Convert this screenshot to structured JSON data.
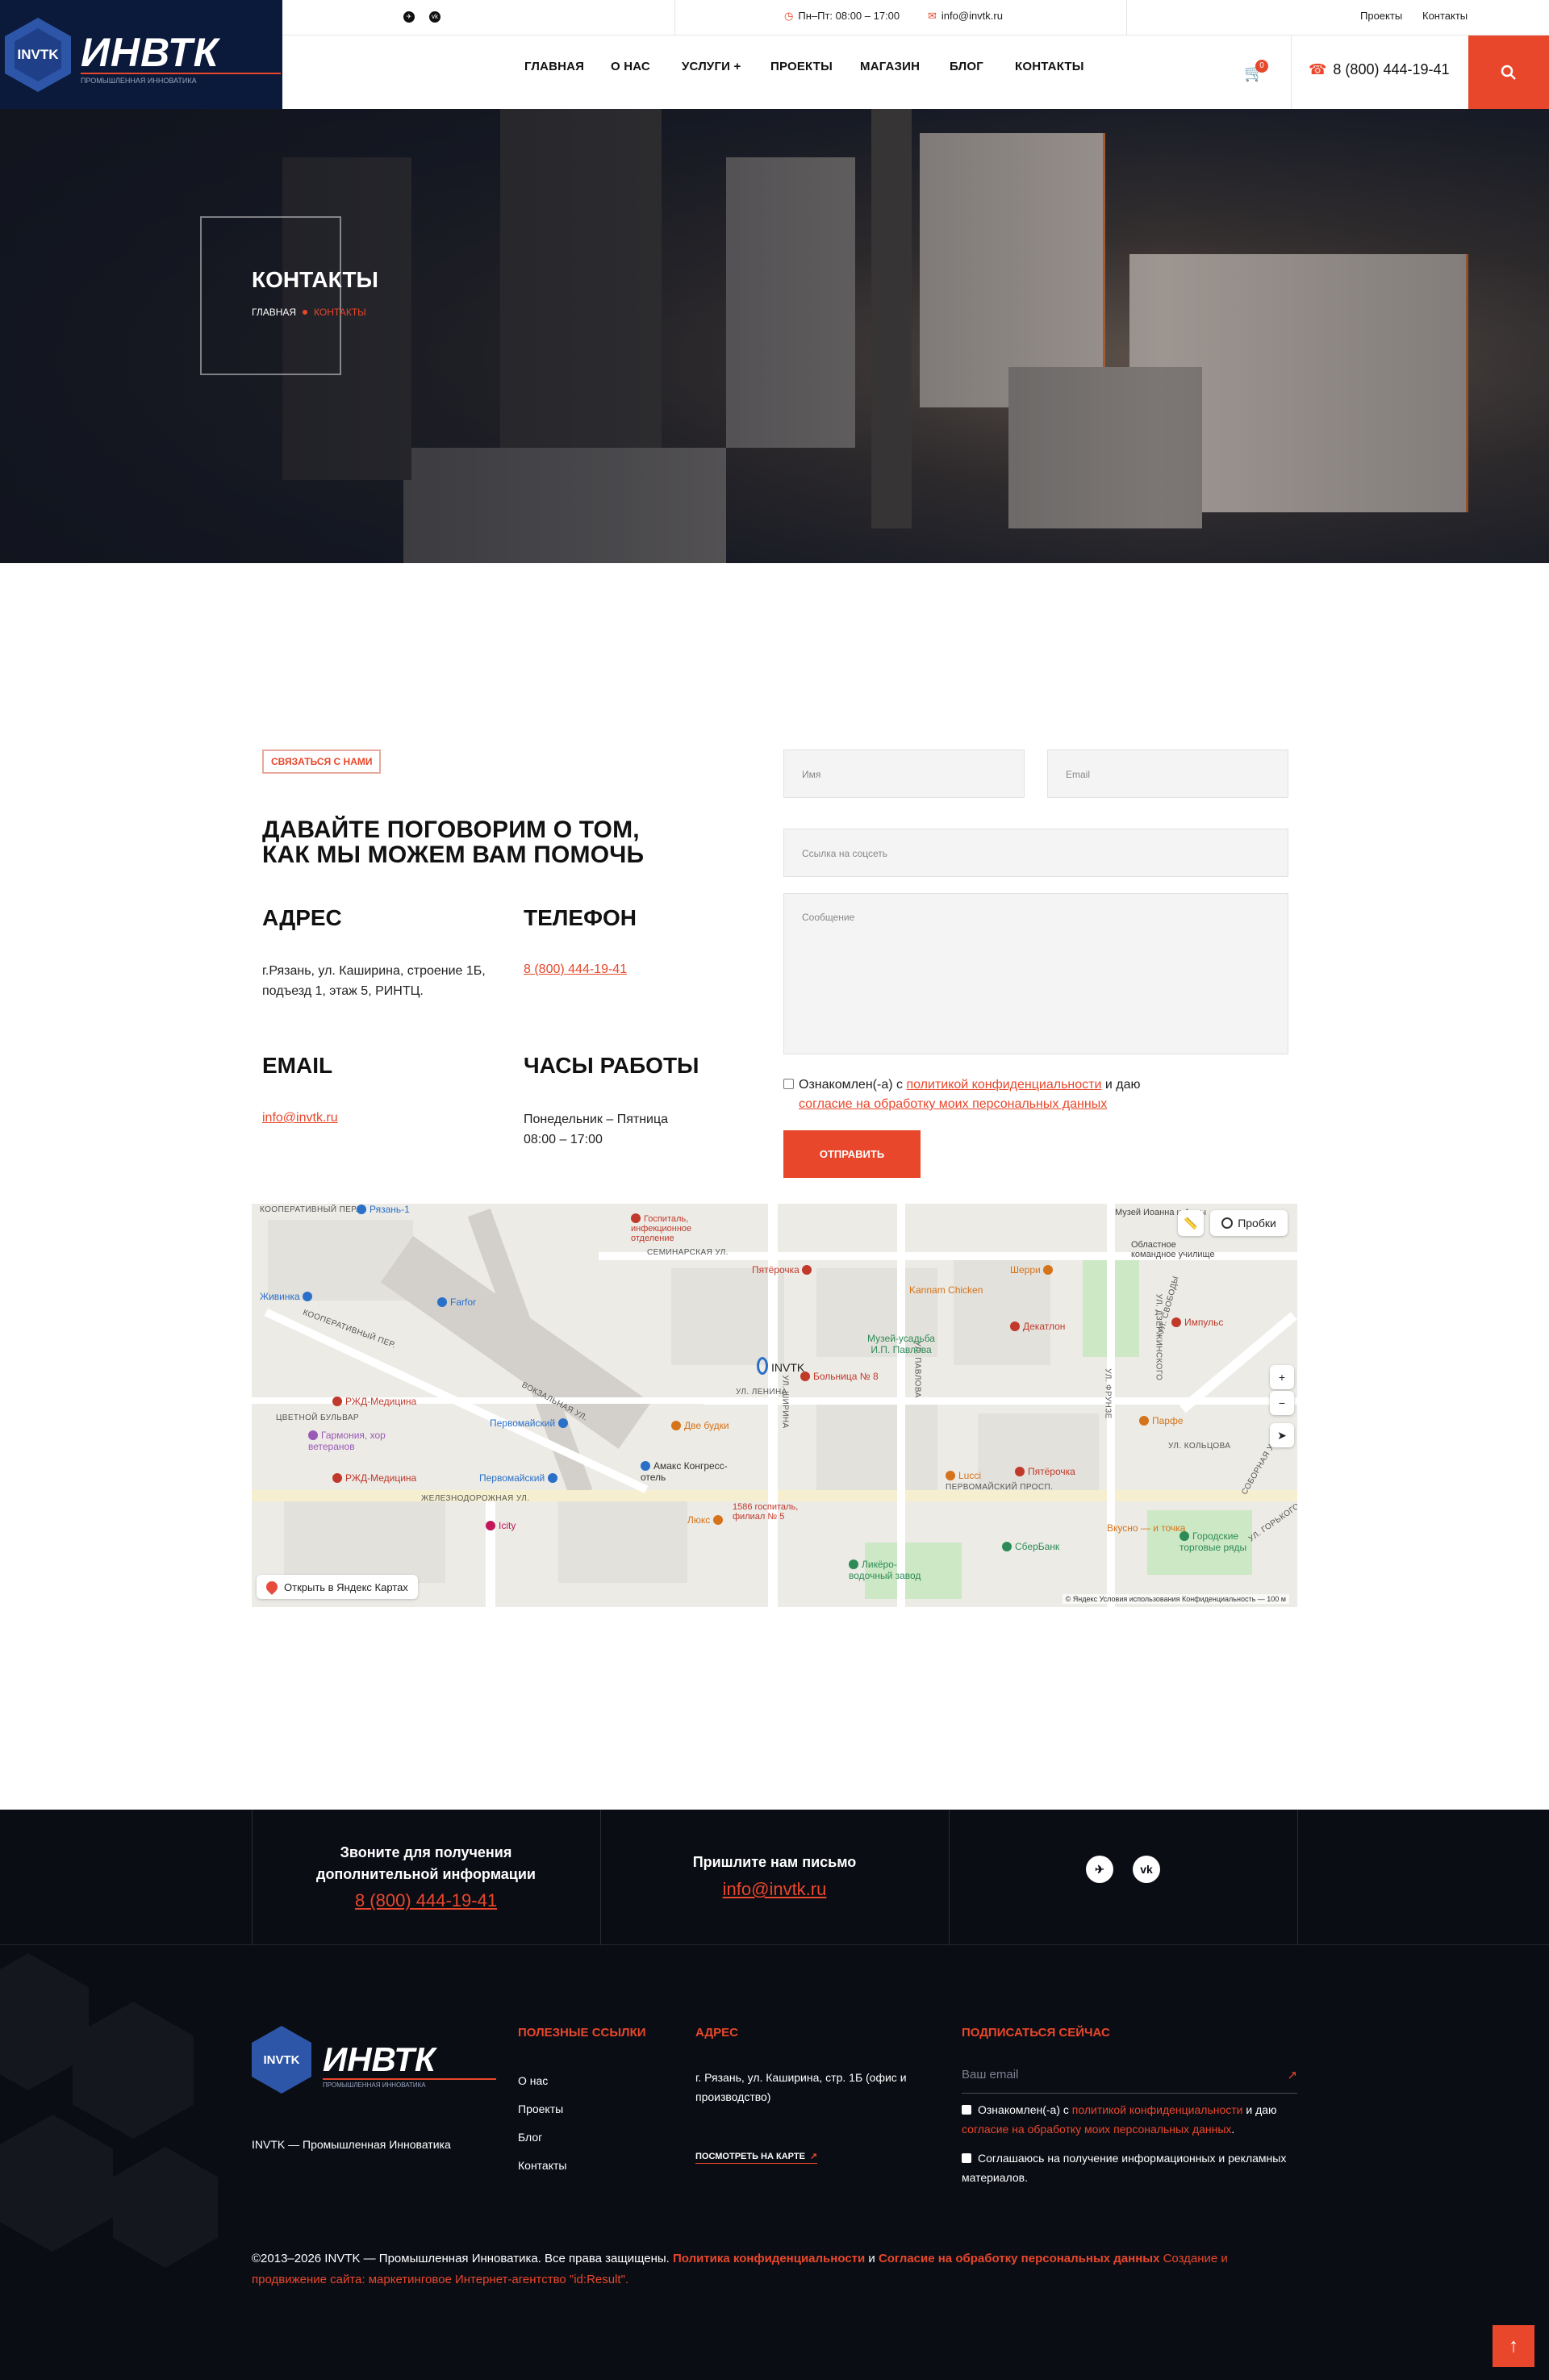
{
  "header": {
    "logo_badge": "INVTK",
    "logo_word": "ИНВТК",
    "logo_sub": "ПРОМЫШЛЕННАЯ ИННОВАТИКА",
    "hours": "Пн–Пт: 08:00 – 17:00",
    "email": "info@invtk.ru",
    "top_links": [
      "Проекты",
      "Контакты"
    ],
    "nav": [
      "Главная",
      "О нас",
      "Услуги +",
      "Проекты",
      "Магазин",
      "Блог",
      "Контакты"
    ],
    "cart_count": "0",
    "phone": "8 (800) 444-19-41"
  },
  "hero": {
    "title": "Контакты",
    "crumb_home": "Главная",
    "crumb_current": "Контакты"
  },
  "contact": {
    "tag": "Связаться с нами",
    "heading_line1": "Давайте поговорим о том,",
    "heading_line2": "как мы можем вам помочь",
    "address_title": "Адрес",
    "address_line1": "г.Рязань, ул. Каширина, строение 1Б,",
    "address_line2": "подъезд 1, этаж 5, РИНТЦ.",
    "phone_title": "Телефон",
    "phone": "8 (800) 444-19-41",
    "email_title": "Email",
    "email": "info@invtk.ru",
    "hours_title": "Часы работы",
    "hours_line1": "Понедельник – Пятница",
    "hours_line2": "08:00 – 17:00"
  },
  "form": {
    "name_ph": "Имя",
    "email_ph": "Email",
    "social_ph": "Ссылка на соцсеть",
    "message_ph": "Сообщение",
    "consent_pre": "Ознакомлен(-а) с",
    "consent_link1": "политикой конфиденциальности",
    "consent_mid": "и даю",
    "consent_link2": "согласие на обработку моих персональных данных",
    "submit": "Отправить"
  },
  "map": {
    "open_link": "Открыть в Яндекс Картах",
    "traffic": "Пробки",
    "marker": "INVTK",
    "copyright": "© Яндекс   Условия использования   Конфиденциальность",
    "scale": "100 м",
    "pois": [
      "Госпиталь, инфекционное отделение",
      "Пятёрочка",
      "Шерри",
      "Живинка",
      "Farfor",
      "Kannam Chicken",
      "Музей-усадьба И.П. Павлова",
      "Декатлон",
      "Импульс",
      "Больница № 8",
      "РЖД-Медицина",
      "Цветной бульвар",
      "Первомайский",
      "Две будки",
      "Парфе",
      "Гармония, хор ветеранов",
      "РЖД-Медицина",
      "Первомайский",
      "Амакс Конгресс-отель",
      "Lucci",
      "Пятёрочка",
      "Icity",
      "Люкс",
      "1586 госпиталь, филиал № 5",
      "СберБанк",
      "Вкусно — и точка",
      "Городские торговые ряды",
      "Ликёро-водочный завод",
      "Рязань-1",
      "Пятёрочка",
      "Музей Иоанна и Анны",
      "Областное командное училище"
    ],
    "streets": [
      "Семинарская ул.",
      "Вокзальная ул.",
      "Ул. Ленина",
      "Первомайский просп.",
      "Ул. Кольцова",
      "Соборная ул.",
      "Ул. Горького",
      "Ул. Павлова",
      "Ул. Ширина",
      "Ул. Фрунзе",
      "Ул. Дзержинского",
      "Ул. Свободы",
      "Кооперативный пер.",
      "Железнодорожная ул."
    ]
  },
  "cbar": {
    "call_title_1": "Звоните для получения",
    "call_title_2": "дополнительной информации",
    "call_phone": "8 (800) 444-19-41",
    "mail_title": "Пришлите нам письмо",
    "mail_email": "info@invtk.ru"
  },
  "footer": {
    "logo_badge": "INVTK",
    "logo_word": "ИНВТК",
    "logo_sub": "ПРОМЫШЛЕННАЯ ИННОВАТИКА",
    "desc": "INVTK — Промышленная Инноватика",
    "links_title": "Полезные ссылки",
    "links": [
      "О нас",
      "Проекты",
      "Блог",
      "Контакты"
    ],
    "address_title": "Адрес",
    "address": "г. Рязань, ул. Каширина, стр. 1Б (офис и производство)",
    "map_link": "Посмотреть на карте",
    "subscribe_title": "Подписаться сейчас",
    "email_ph": "Ваш email",
    "chk1_pre": "Ознакомлен(-а) с",
    "chk1_link1": "политикой конфиденциальности",
    "chk1_mid": "и даю",
    "chk1_link2": "согласие на обработку моих персональных данных",
    "chk2": "Соглашаюсь на получение информационных и рекламных материалов.",
    "copy_pre": "©2013–2026 INVTK — Промышленная Инноватика. Все права защищены.",
    "copy_policy": "Политика конфиденциальности",
    "copy_and": "и",
    "copy_consent": "Согласие на обработку персональных данных",
    "copy_dev": "Создание и продвижение сайта: маркетинговое Интернет-агентство \"id:Result\"."
  },
  "colors": {
    "accent": "#e8472b",
    "dark": "#0b0d15",
    "navy": "#0b1a3a"
  }
}
